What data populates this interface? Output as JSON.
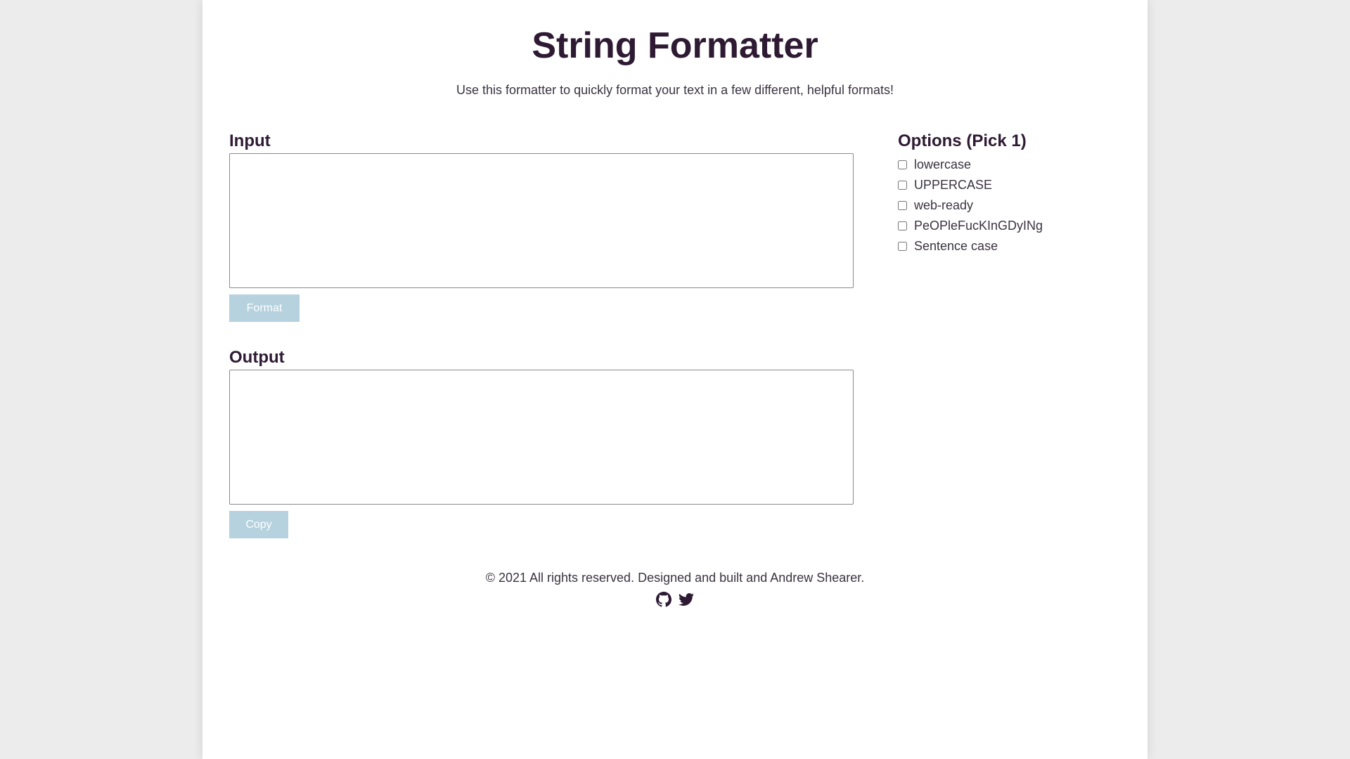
{
  "header": {
    "title": "String Formatter",
    "subtitle": "Use this formatter to quickly format your text in a few different, helpful formats!"
  },
  "input": {
    "label": "Input",
    "value": "",
    "button_label": "Format"
  },
  "output": {
    "label": "Output",
    "value": "",
    "button_label": "Copy"
  },
  "options": {
    "title": "Options (Pick 1)",
    "items": [
      {
        "label": "lowercase",
        "checked": false
      },
      {
        "label": "UPPERCASE",
        "checked": false
      },
      {
        "label": "web-ready",
        "checked": false
      },
      {
        "label": "PeOPleFucKInGDyINg",
        "checked": false
      },
      {
        "label": "Sentence case",
        "checked": false
      }
    ]
  },
  "footer": {
    "text": "© 2021 All rights reserved. Designed and built and Andrew Shearer.",
    "icons": [
      "github-icon",
      "twitter-icon"
    ]
  },
  "colors": {
    "heading": "#2e1a33",
    "button_bg": "#b5d2de",
    "page_bg": "#ececec"
  }
}
